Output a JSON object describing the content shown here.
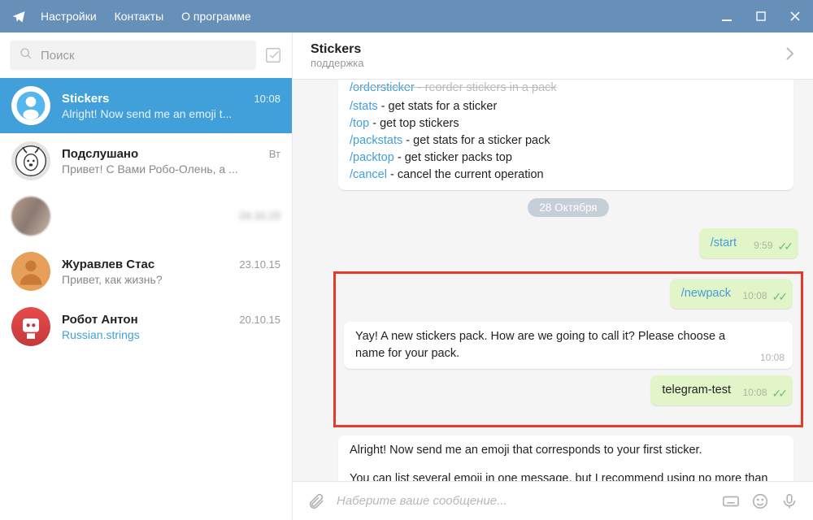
{
  "titlebar": {
    "menu": [
      "Настройки",
      "Контакты",
      "О программе"
    ]
  },
  "sidebar": {
    "search_placeholder": "Поиск",
    "chats": [
      {
        "name": "Stickers",
        "time": "10:08",
        "preview": "Alright! Now send me an emoji t...",
        "active": true,
        "avclass": "av-stickers"
      },
      {
        "name": "Подслушано",
        "time": "Вт",
        "preview": "Привет! С Вами Робо-Олень, а ...",
        "avclass": "av-deer"
      },
      {
        "name": "",
        "time": "24.10.15",
        "preview": "",
        "avclass": "av-blur",
        "blurred": true
      },
      {
        "name": "Журавлев Стас",
        "time": "23.10.15",
        "preview": "Привет, как жизнь?",
        "avclass": "av-sil"
      },
      {
        "name": "Робот Антон",
        "time": "20.10.15",
        "preview": "Russian.strings",
        "previewlink": true,
        "avclass": "av-robot"
      }
    ]
  },
  "chat": {
    "title": "Stickers",
    "subtitle": "поддержка",
    "commands": [
      {
        "cmd": "/stats",
        "desc": " - get stats for a sticker"
      },
      {
        "cmd": "/top",
        "desc": " - get top stickers"
      },
      {
        "cmd": "/packstats",
        "desc": " - get stats for a sticker pack"
      },
      {
        "cmd": "/packtop",
        "desc": " - get sticker packs top"
      },
      {
        "cmd": "/cancel",
        "desc": " - cancel the current operation"
      }
    ],
    "cmdhead_cmd": "/ordersticker",
    "cmdhead_desc": " - reorder stickers in a pack",
    "date_chip": "28 Октября",
    "m_start": {
      "text": "/start",
      "time": "9:59"
    },
    "m_newpack": {
      "text": "/newpack",
      "time": "10:08"
    },
    "m_yay": {
      "text": "Yay! A new stickers pack. How are we going to call it? Please choose a name for your pack.",
      "time": "10:08"
    },
    "m_tg": {
      "text": "telegram-test",
      "time": "10:08"
    },
    "m_alright1": "Alright! Now send me an emoji that corresponds to your first sticker.",
    "m_alright2": "You can list several emoji in one message, but I recommend using no more than two per sticker.",
    "input_placeholder": "Наберите ваше сообщение..."
  }
}
